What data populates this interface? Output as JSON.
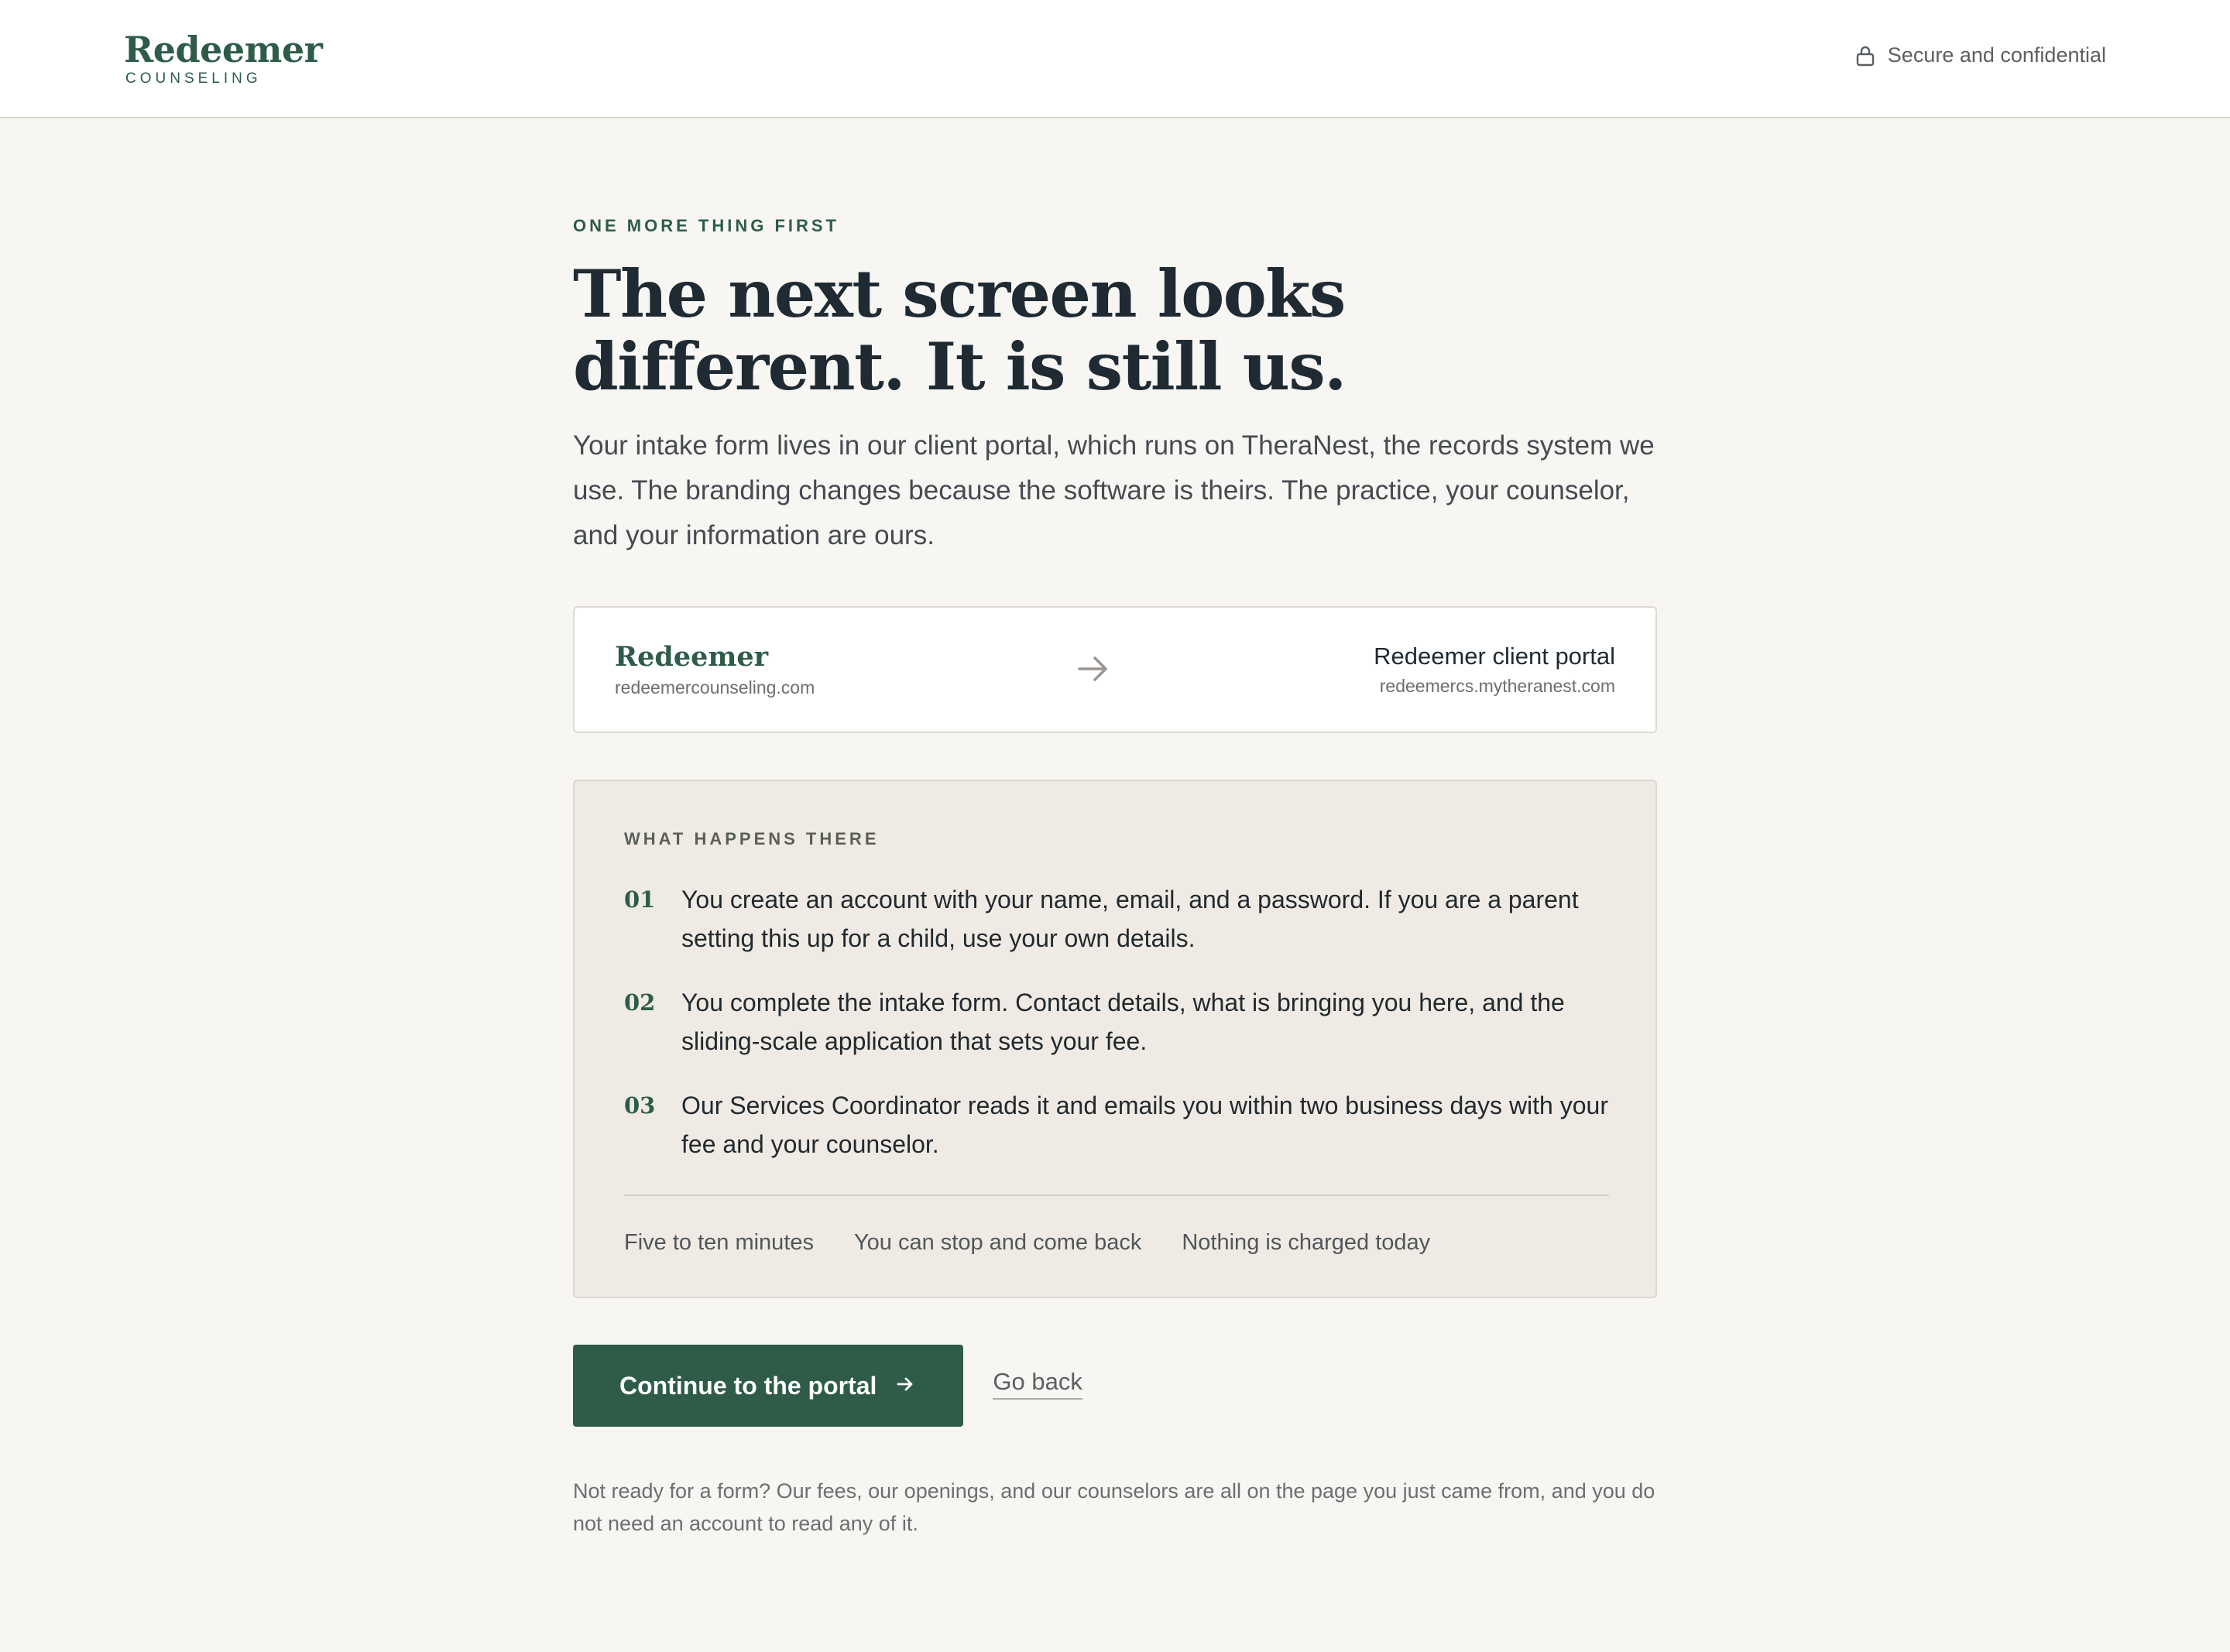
{
  "header": {
    "brand_name": "Redeemer",
    "brand_sub": "COUNSELING",
    "secure_label": "Secure and confidential"
  },
  "intro": {
    "eyebrow": "ONE MORE THING FIRST",
    "headline": "The next screen looks different. It is still us.",
    "lede": "Your intake form lives in our client portal, which runs on TheraNest, the records system we use. The branding changes because the software is theirs. The practice, your counselor, and your information are ours."
  },
  "route": {
    "from_name": "Redeemer",
    "from_url": "redeemercounseling.com",
    "to_name": "Redeemer client portal",
    "to_url": "redeemercs.mytheranest.com"
  },
  "happens": {
    "label": "WHAT HAPPENS THERE",
    "steps": [
      {
        "num": "01",
        "text": "You create an account with your name, email, and a password. If you are a parent setting this up for a child, use your own details."
      },
      {
        "num": "02",
        "text": "You complete the intake form. Contact details, what is bringing you here, and the sliding-scale application that sets your fee."
      },
      {
        "num": "03",
        "text": "Our Services Coordinator reads it and emails you within two business days with your fee and your counselor."
      }
    ],
    "facts": [
      "Five to ten minutes",
      "You can stop and come back",
      "Nothing is charged today"
    ]
  },
  "actions": {
    "continue_label": "Continue to the portal",
    "back_label": "Go back"
  },
  "footnote": "Not ready for a form? Our fees, our openings, and our counselors are all on the page you just came from, and you do not need an account to read any of it.",
  "colors": {
    "brand_green": "#2e5c48",
    "page_bg": "#f7f6f2",
    "panel_bg": "#efebe4"
  },
  "icons": {
    "secure": "lock-icon",
    "route": "arrow-right-icon",
    "continue": "arrow-right-icon"
  }
}
